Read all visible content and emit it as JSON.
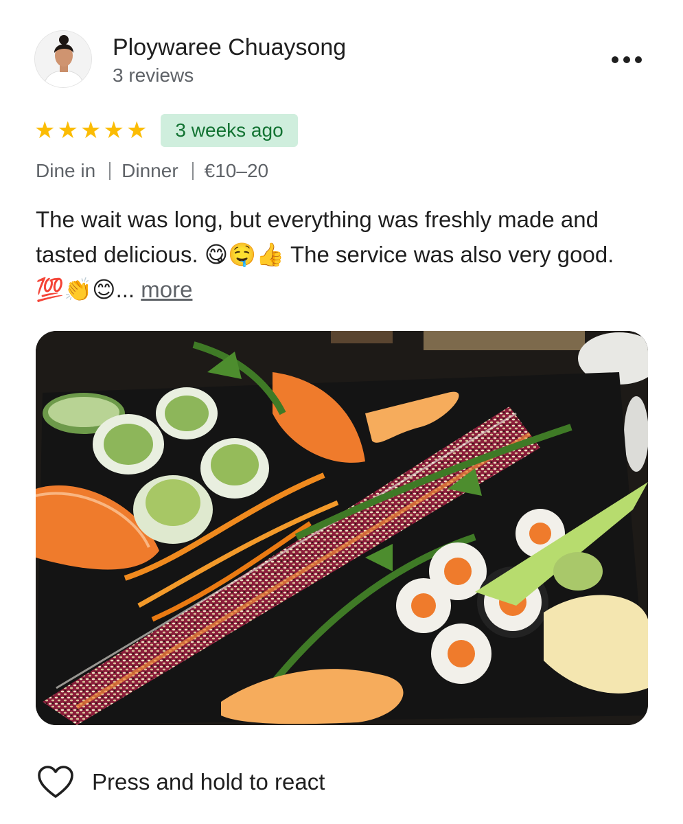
{
  "reviewer": {
    "name": "Ploywaree Chuaysong",
    "review_count": "3 reviews",
    "avatar_icon": "person-portrait-icon"
  },
  "menu": {
    "icon": "more-horizontal-icon"
  },
  "rating": {
    "stars": 5,
    "max_stars": 5,
    "star_char": "★",
    "star_color": "#fbbc04"
  },
  "time_badge": {
    "text": "3 weeks ago",
    "bg": "#cfeedd",
    "color": "#137333"
  },
  "meta": {
    "service": "Dine in",
    "meal": "Dinner",
    "price": "€10–20"
  },
  "review": {
    "text": "The wait was long, but everything was freshly made and tasted delicious. 😋🤤👍  The service was also very good. 💯👏😊",
    "ellipsis": "...",
    "more_label": "more"
  },
  "photo": {
    "icon": "sushi-platter-photo"
  },
  "react": {
    "label": "Press and hold to react",
    "icon": "heart-outline-icon"
  }
}
